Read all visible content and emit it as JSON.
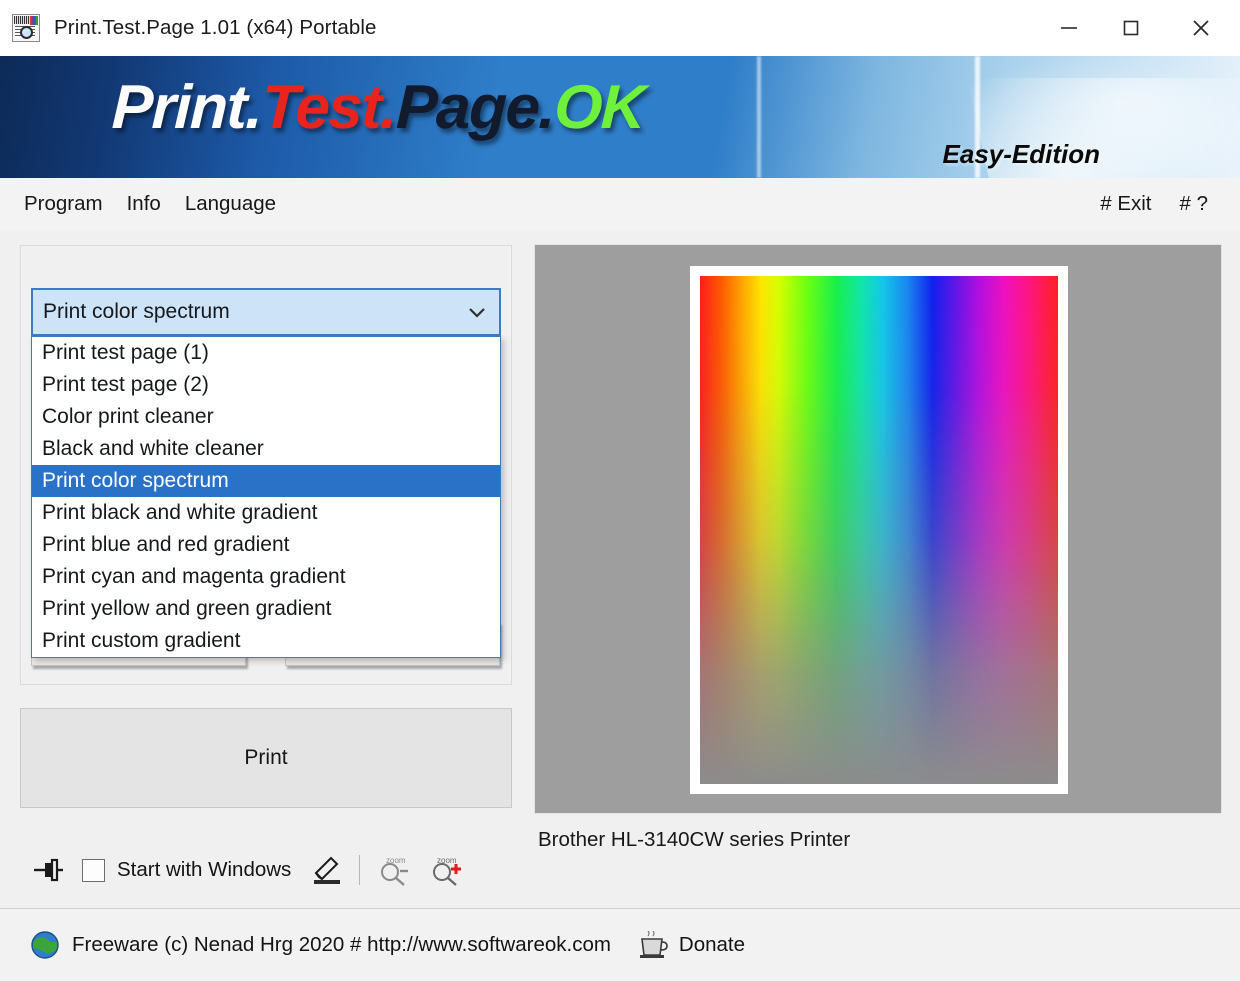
{
  "window": {
    "title": "Print.Test.Page 1.01  (x64) Portable",
    "icon": "printer-test-page-icon",
    "minimize_label": "minimize-icon",
    "maximize_label": "maximize-icon",
    "close_label": "close-icon"
  },
  "banner": {
    "part_print": "Print.",
    "part_test": "Test.",
    "part_page": "Page.",
    "part_ok": "OK",
    "edition": "Easy-Edition",
    "colors": {
      "print": "#fdfdfd",
      "test": "#e8241c",
      "page": "#121a2e",
      "ok": "#6ff03a",
      "bg_dark": "#0d2a57",
      "bg_mid": "#2f7ec9",
      "bg_light": "#e7f2fb"
    }
  },
  "menu": {
    "left_items": [
      {
        "label": "Program"
      },
      {
        "label": "Info"
      },
      {
        "label": "Language"
      }
    ],
    "right_items": [
      {
        "label": "# Exit"
      },
      {
        "label": "# ?"
      }
    ]
  },
  "main": {
    "combo": {
      "value": "Print color spectrum",
      "arrow_icon": "chevron-down-icon",
      "options": [
        "Print test page (1)",
        "Print test page (2)",
        "Color print cleaner",
        "Black and white cleaner",
        "Print color spectrum",
        "Print black and white gradient",
        "Print blue and red gradient",
        "Print cyan and magenta gradient",
        "Print yellow and green gradient",
        "Print custom gradient"
      ],
      "selected_index": 4,
      "selection_bg": "#2a72c8",
      "field_bg": "#cde3f7",
      "field_border": "#3b7dc4"
    },
    "print_button": {
      "label": "Print"
    },
    "options": {
      "pin_icon": "pushpin-icon",
      "start_with_windows": {
        "label": "Start with Windows",
        "checked": false
      },
      "edit_icon": "pencil-icon",
      "zoom_out_icon": "zoom-out-magnifier-icon",
      "zoom_in_icon": "zoom-in-magnifier-icon"
    }
  },
  "preview": {
    "background_color": "#9e9e9e",
    "paper_color": "#ffffff",
    "content_type": "color-spectrum-gradient",
    "printer_name": "Brother HL-3140CW series Printer"
  },
  "statusbar": {
    "globe_icon": "globe-icon",
    "text": "Freeware (c) Nenad Hrg 2020 # http://www.softwareok.com",
    "cup_icon": "coffee-cup-icon",
    "donate_label": "Donate"
  }
}
